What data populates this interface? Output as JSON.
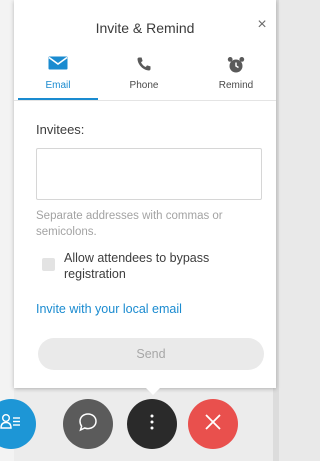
{
  "dialog": {
    "title": "Invite & Remind",
    "close_glyph": "×",
    "tabs": [
      {
        "label": "Email",
        "icon": "envelope-icon",
        "active": true
      },
      {
        "label": "Phone",
        "icon": "phone-icon",
        "active": false
      },
      {
        "label": "Remind",
        "icon": "alarm-clock-icon",
        "active": false
      }
    ],
    "invitees_label": "Invitees:",
    "invitees_value": "",
    "hint": "Separate addresses with commas or semicolons.",
    "bypass_checkbox": {
      "label": "Allow attendees to bypass registration",
      "checked": false
    },
    "local_email_link": "Invite with your local email",
    "send_label": "Send"
  },
  "controls": [
    {
      "name": "participants",
      "icon": "participants-icon",
      "color": "#1d96d6"
    },
    {
      "name": "chat",
      "icon": "chat-bubble-icon",
      "color": "#5b5b5b"
    },
    {
      "name": "more",
      "icon": "more-vertical-icon",
      "color": "#2a2a2a"
    },
    {
      "name": "leave",
      "icon": "close-x-icon",
      "color": "#e9504d"
    }
  ],
  "colors": {
    "accent": "#1a8bd0",
    "muted_text": "#a3a3a3"
  }
}
